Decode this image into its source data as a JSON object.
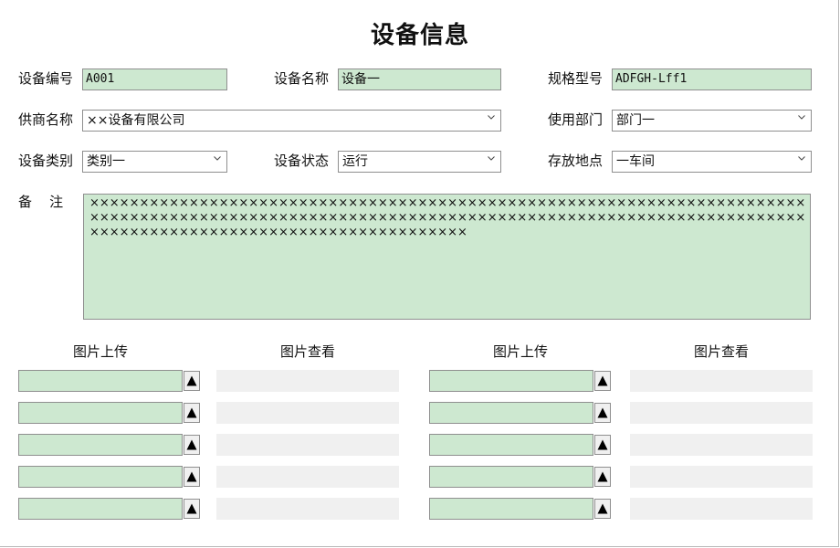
{
  "form": {
    "title": "设备信息",
    "labels": {
      "equip_no": "设备编号",
      "equip_name": "设备名称",
      "spec": "规格型号",
      "supplier": "供商名称",
      "department": "使用部门",
      "category": "设备类别",
      "status": "设备状态",
      "location": "存放地点",
      "remark": "备    注"
    },
    "values": {
      "equip_no": "A001",
      "equip_name": "设备一",
      "spec": "ADFGH-Lff1",
      "supplier": "××设备有限公司",
      "department": "部门一",
      "category": "类别一",
      "status": "运行",
      "location": "一车间",
      "remark": "××××××××××××××××××××××××××××××××××××××××××××××××××××××××××××××××××××××××××××××××××××××××××××××××××××××××××××××××××××××××××××××××××××××××××××××××××××××××××××××××××××××××××××××××××××××"
    }
  },
  "images": {
    "upload_header": "图片上传",
    "view_header": "图片查看",
    "rows_per_column": 5,
    "upload_icon": "triangle-up-icon"
  },
  "colors": {
    "field_bg": "#cde8d0",
    "view_bg": "#f0f0f0",
    "border": "#8f8f8f"
  }
}
